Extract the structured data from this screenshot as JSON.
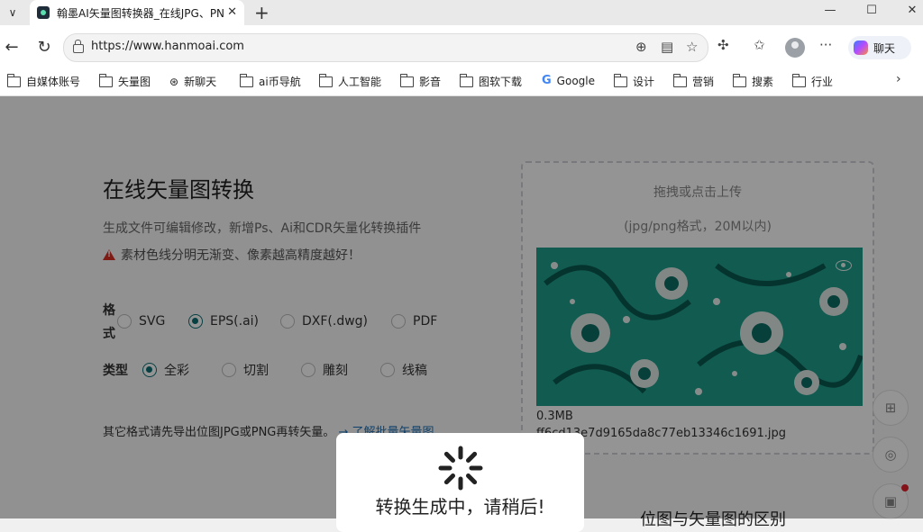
{
  "browser": {
    "tab_title": "翰墨AI矢量图转换器_在线JPG、PNG",
    "url": "https://www.hanmoai.com",
    "copilot_label": "聊天",
    "icons": {
      "tab_menu": "chevron-down-icon",
      "tab_close": "close-icon",
      "new_tab": "plus-icon",
      "back": "back-arrow-icon",
      "refresh": "refresh-icon",
      "zoom": "zoom-icon",
      "reader": "reader-icon",
      "favorite": "star-icon",
      "extensions": "puzzle-icon",
      "favorites": "favorites-icon",
      "more": "more-icon"
    },
    "window_glyphs": {
      "minimize": "—",
      "maximize": "☐",
      "close": "✕",
      "tab_menu": "∨",
      "tab_close": "✕",
      "new_tab": "+",
      "back": "←",
      "refresh": "↻",
      "zoom": "⊕",
      "reader": "▤",
      "star": "☆",
      "extensions": "✣",
      "favorites": "✩",
      "more": "···",
      "bm_more": "›"
    }
  },
  "bookmarks": [
    {
      "label": "自媒体账号",
      "icon": "folder-icon"
    },
    {
      "label": "矢量图",
      "icon": "folder-icon"
    },
    {
      "label": "新聊天",
      "icon": "chat-icon"
    },
    {
      "label": "ai币导航",
      "icon": "folder-icon"
    },
    {
      "label": "人工智能",
      "icon": "folder-icon"
    },
    {
      "label": "影音",
      "icon": "folder-icon"
    },
    {
      "label": "图软下载",
      "icon": "folder-icon"
    },
    {
      "label": "Google",
      "icon": "google-icon"
    },
    {
      "label": "设计",
      "icon": "folder-icon"
    },
    {
      "label": "营销",
      "icon": "folder-icon"
    },
    {
      "label": "搜素",
      "icon": "folder-icon"
    },
    {
      "label": "行业",
      "icon": "folder-icon"
    }
  ],
  "page": {
    "heading": "在线矢量图转换",
    "subtitle": "生成文件可编辑修改，新增Ps、Ai和CDR矢量化转换插件",
    "warning": "素材色线分明无渐变、像素越高精度越好！",
    "format_label": "格式",
    "format_options": [
      {
        "label": "SVG",
        "selected": false
      },
      {
        "label": "EPS(.ai)",
        "selected": true
      },
      {
        "label": "DXF(.dwg)",
        "selected": false
      },
      {
        "label": "PDF",
        "selected": false
      }
    ],
    "type_label": "类型",
    "type_options": [
      {
        "label": "全彩",
        "selected": true
      },
      {
        "label": "切割",
        "selected": false
      },
      {
        "label": "雕刻",
        "selected": false
      },
      {
        "label": "线稿",
        "selected": false
      }
    ],
    "note": "其它格式请先导出位图JPG或PNG再转矢量。",
    "note_link": "→ 了解批量矢量图",
    "upload": {
      "line1": "拖拽或点击上传",
      "line2": "(jpg/png格式，20M以内)",
      "file_size": "0.3MB",
      "file_name": "ff6cd13e7d9165da8c77eb13346c1691.jpg"
    },
    "next_heading": "位图与矢量图的区别",
    "side_buttons": [
      "qr-code-icon",
      "chat-bubble-icon",
      "gift-icon"
    ],
    "side_glyphs": [
      "⊞",
      "◎",
      "▣"
    ]
  },
  "modal": {
    "text": "转换生成中，请稍后!",
    "icon": "loading-spinner-icon"
  },
  "colors": {
    "accent": "#0b6e74",
    "warning": "#d93025",
    "link": "#1a6fb5",
    "pattern": "#1f9e8b"
  }
}
